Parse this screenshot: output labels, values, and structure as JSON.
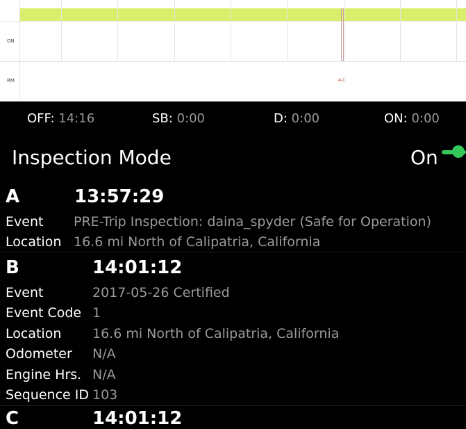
{
  "graph": {
    "rows": [
      "ON",
      "RM"
    ],
    "event_label": "A-C"
  },
  "totals": [
    {
      "key": "OFF:",
      "value": "14:16"
    },
    {
      "key": "SB:",
      "value": "0:00"
    },
    {
      "key": "D:",
      "value": "0:00"
    },
    {
      "key": "ON:",
      "value": "0:00"
    }
  ],
  "inspection": {
    "title": "Inspection Mode",
    "state": "On"
  },
  "events": [
    {
      "letter": "A",
      "time": "13:57:29",
      "fields": [
        {
          "label": "Event",
          "value": "PRE-Trip Inspection: daina_spyder (Safe for Operation)"
        },
        {
          "label": "Location",
          "value": "16.6 mi North of Calipatria, California"
        }
      ]
    },
    {
      "letter": "B",
      "time": "14:01:12",
      "fields": [
        {
          "label": "Event",
          "value": "2017-05-26 Certified"
        },
        {
          "label": "Event Code",
          "value": "1"
        },
        {
          "label": "Location",
          "value": "16.6 mi North of Calipatria, California"
        },
        {
          "label": "Odometer",
          "value": "N/A"
        },
        {
          "label": "Engine Hrs.",
          "value": "N/A"
        },
        {
          "label": "Sequence ID",
          "value": "103"
        }
      ]
    },
    {
      "letter": "C",
      "time": "14:01:12",
      "fields": []
    }
  ]
}
